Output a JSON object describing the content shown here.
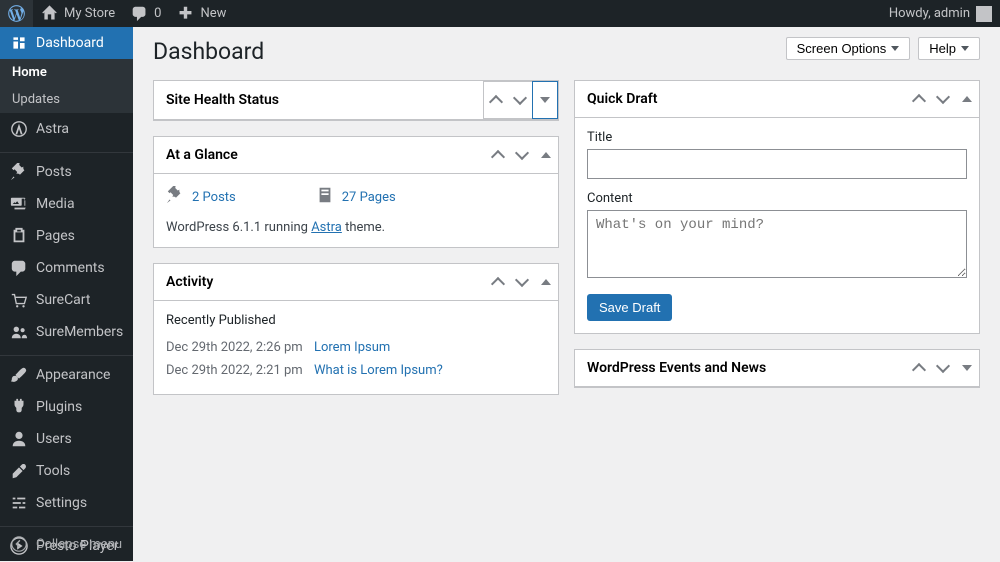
{
  "adminbar": {
    "site_name": "My Store",
    "comment_count": "0",
    "new_label": "New",
    "greeting": "Howdy, admin"
  },
  "screen_options_label": "Screen Options",
  "help_label": "Help",
  "page_title": "Dashboard",
  "sidebar": {
    "dashboard": "Dashboard",
    "home": "Home",
    "updates": "Updates",
    "astra": "Astra",
    "posts": "Posts",
    "media": "Media",
    "pages": "Pages",
    "comments": "Comments",
    "surecart": "SureCart",
    "suremembers": "SureMembers",
    "appearance": "Appearance",
    "plugins": "Plugins",
    "users": "Users",
    "tools": "Tools",
    "settings": "Settings",
    "presto": "Presto Player",
    "collapse": "Collapse menu"
  },
  "site_health": {
    "title": "Site Health Status"
  },
  "glance": {
    "title": "At a Glance",
    "posts": "2 Posts",
    "pages": "27 Pages",
    "wp_prefix": "WordPress 6.1.1 running ",
    "theme_name": "Astra",
    "wp_suffix": " theme."
  },
  "activity": {
    "title": "Activity",
    "section": "Recently Published",
    "rows": [
      {
        "date": "Dec 29th 2022, 2:26 pm",
        "title": "Lorem Ipsum"
      },
      {
        "date": "Dec 29th 2022, 2:21 pm",
        "title": "What is Lorem Ipsum?"
      }
    ]
  },
  "quick_draft": {
    "title": "Quick Draft",
    "title_label": "Title",
    "content_label": "Content",
    "placeholder": "What's on your mind?",
    "save_label": "Save Draft"
  },
  "events": {
    "title": "WordPress Events and News"
  }
}
